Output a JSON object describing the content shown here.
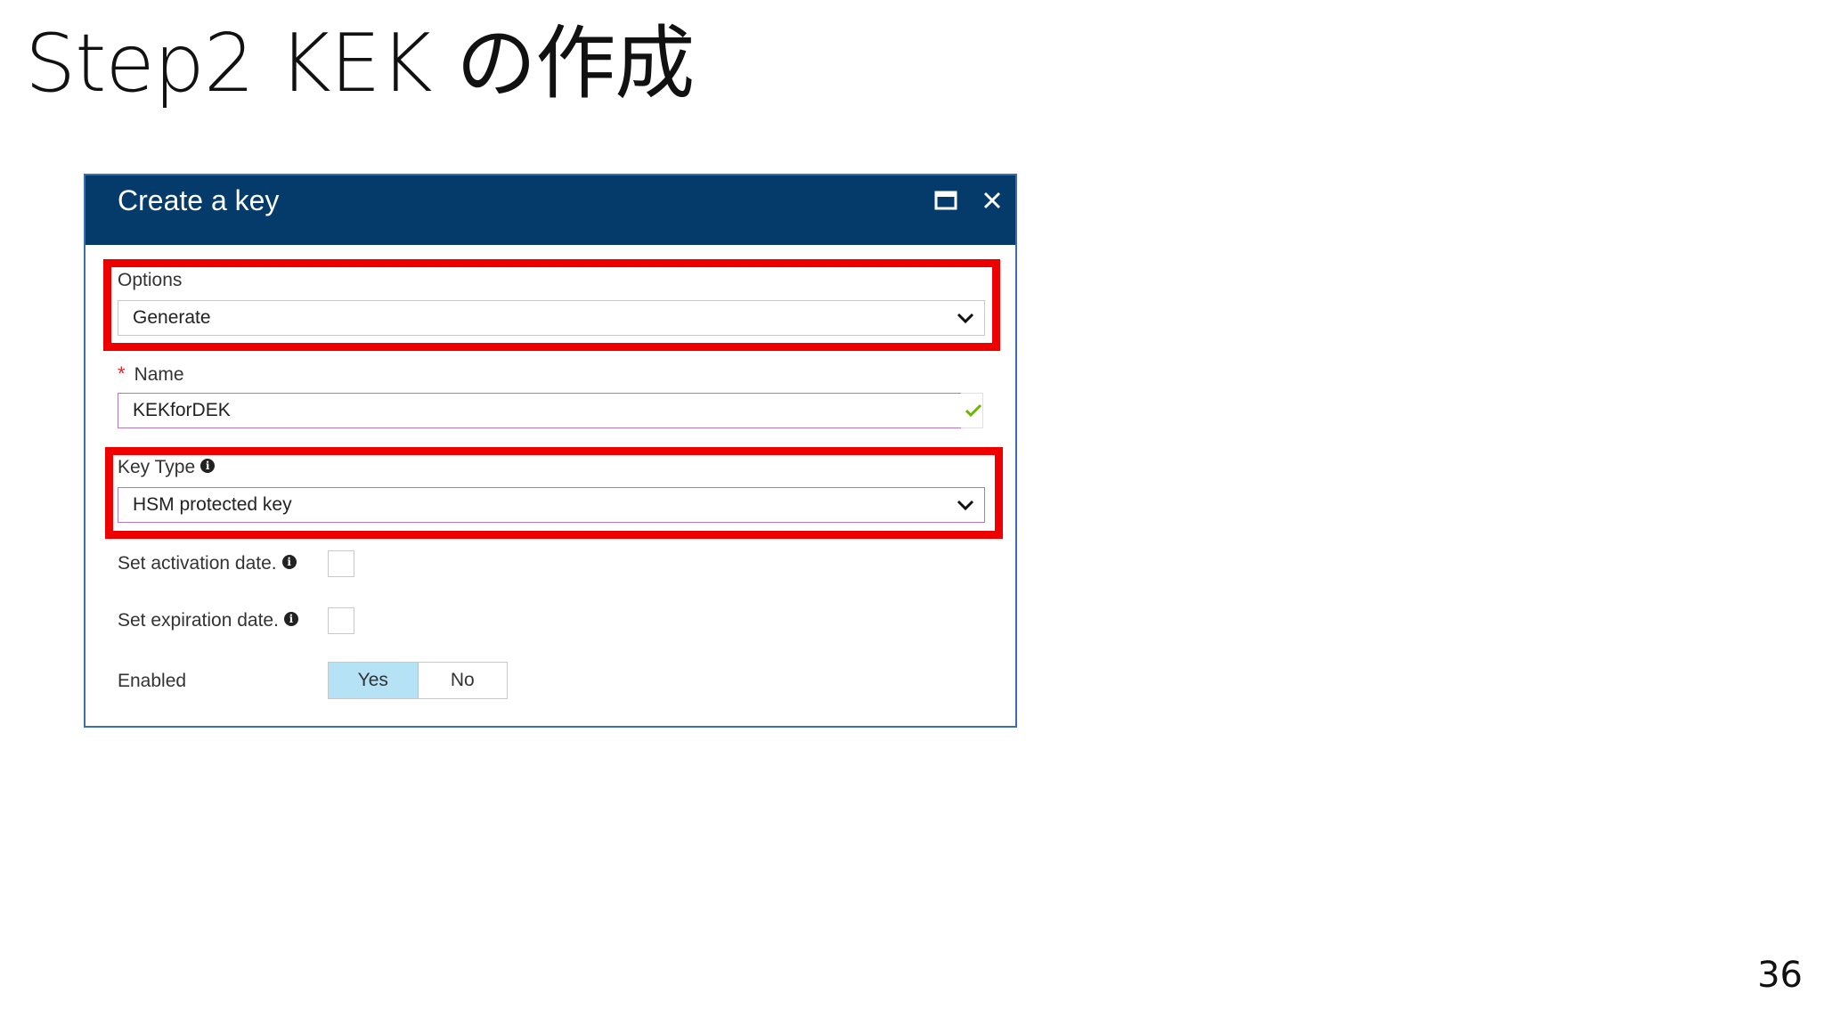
{
  "slide": {
    "title": "Step2 KEK の作成",
    "page_number": "36"
  },
  "dialog": {
    "title": "Create a key",
    "options": {
      "label": "Options",
      "value": "Generate"
    },
    "name": {
      "required_marker": "*",
      "label": "Name",
      "value": "KEKforDEK"
    },
    "key_type": {
      "label": "Key Type",
      "value": "HSM protected key"
    },
    "activation_date": {
      "label": "Set activation date."
    },
    "expiration_date": {
      "label": "Set expiration date."
    },
    "enabled": {
      "label": "Enabled",
      "yes_label": "Yes",
      "no_label": "No",
      "selected": "Yes"
    },
    "icons": {
      "maximize": "maximize-icon",
      "close": "close-icon",
      "chevron": "chevron-down-icon",
      "info": "info-icon",
      "valid": "checkmark-icon"
    },
    "colors": {
      "header": "#053b6a",
      "highlight": "#ee0000",
      "toggle_selected": "#b6e2f6",
      "valid_check": "#6bb700",
      "required": "#d9262a"
    }
  }
}
